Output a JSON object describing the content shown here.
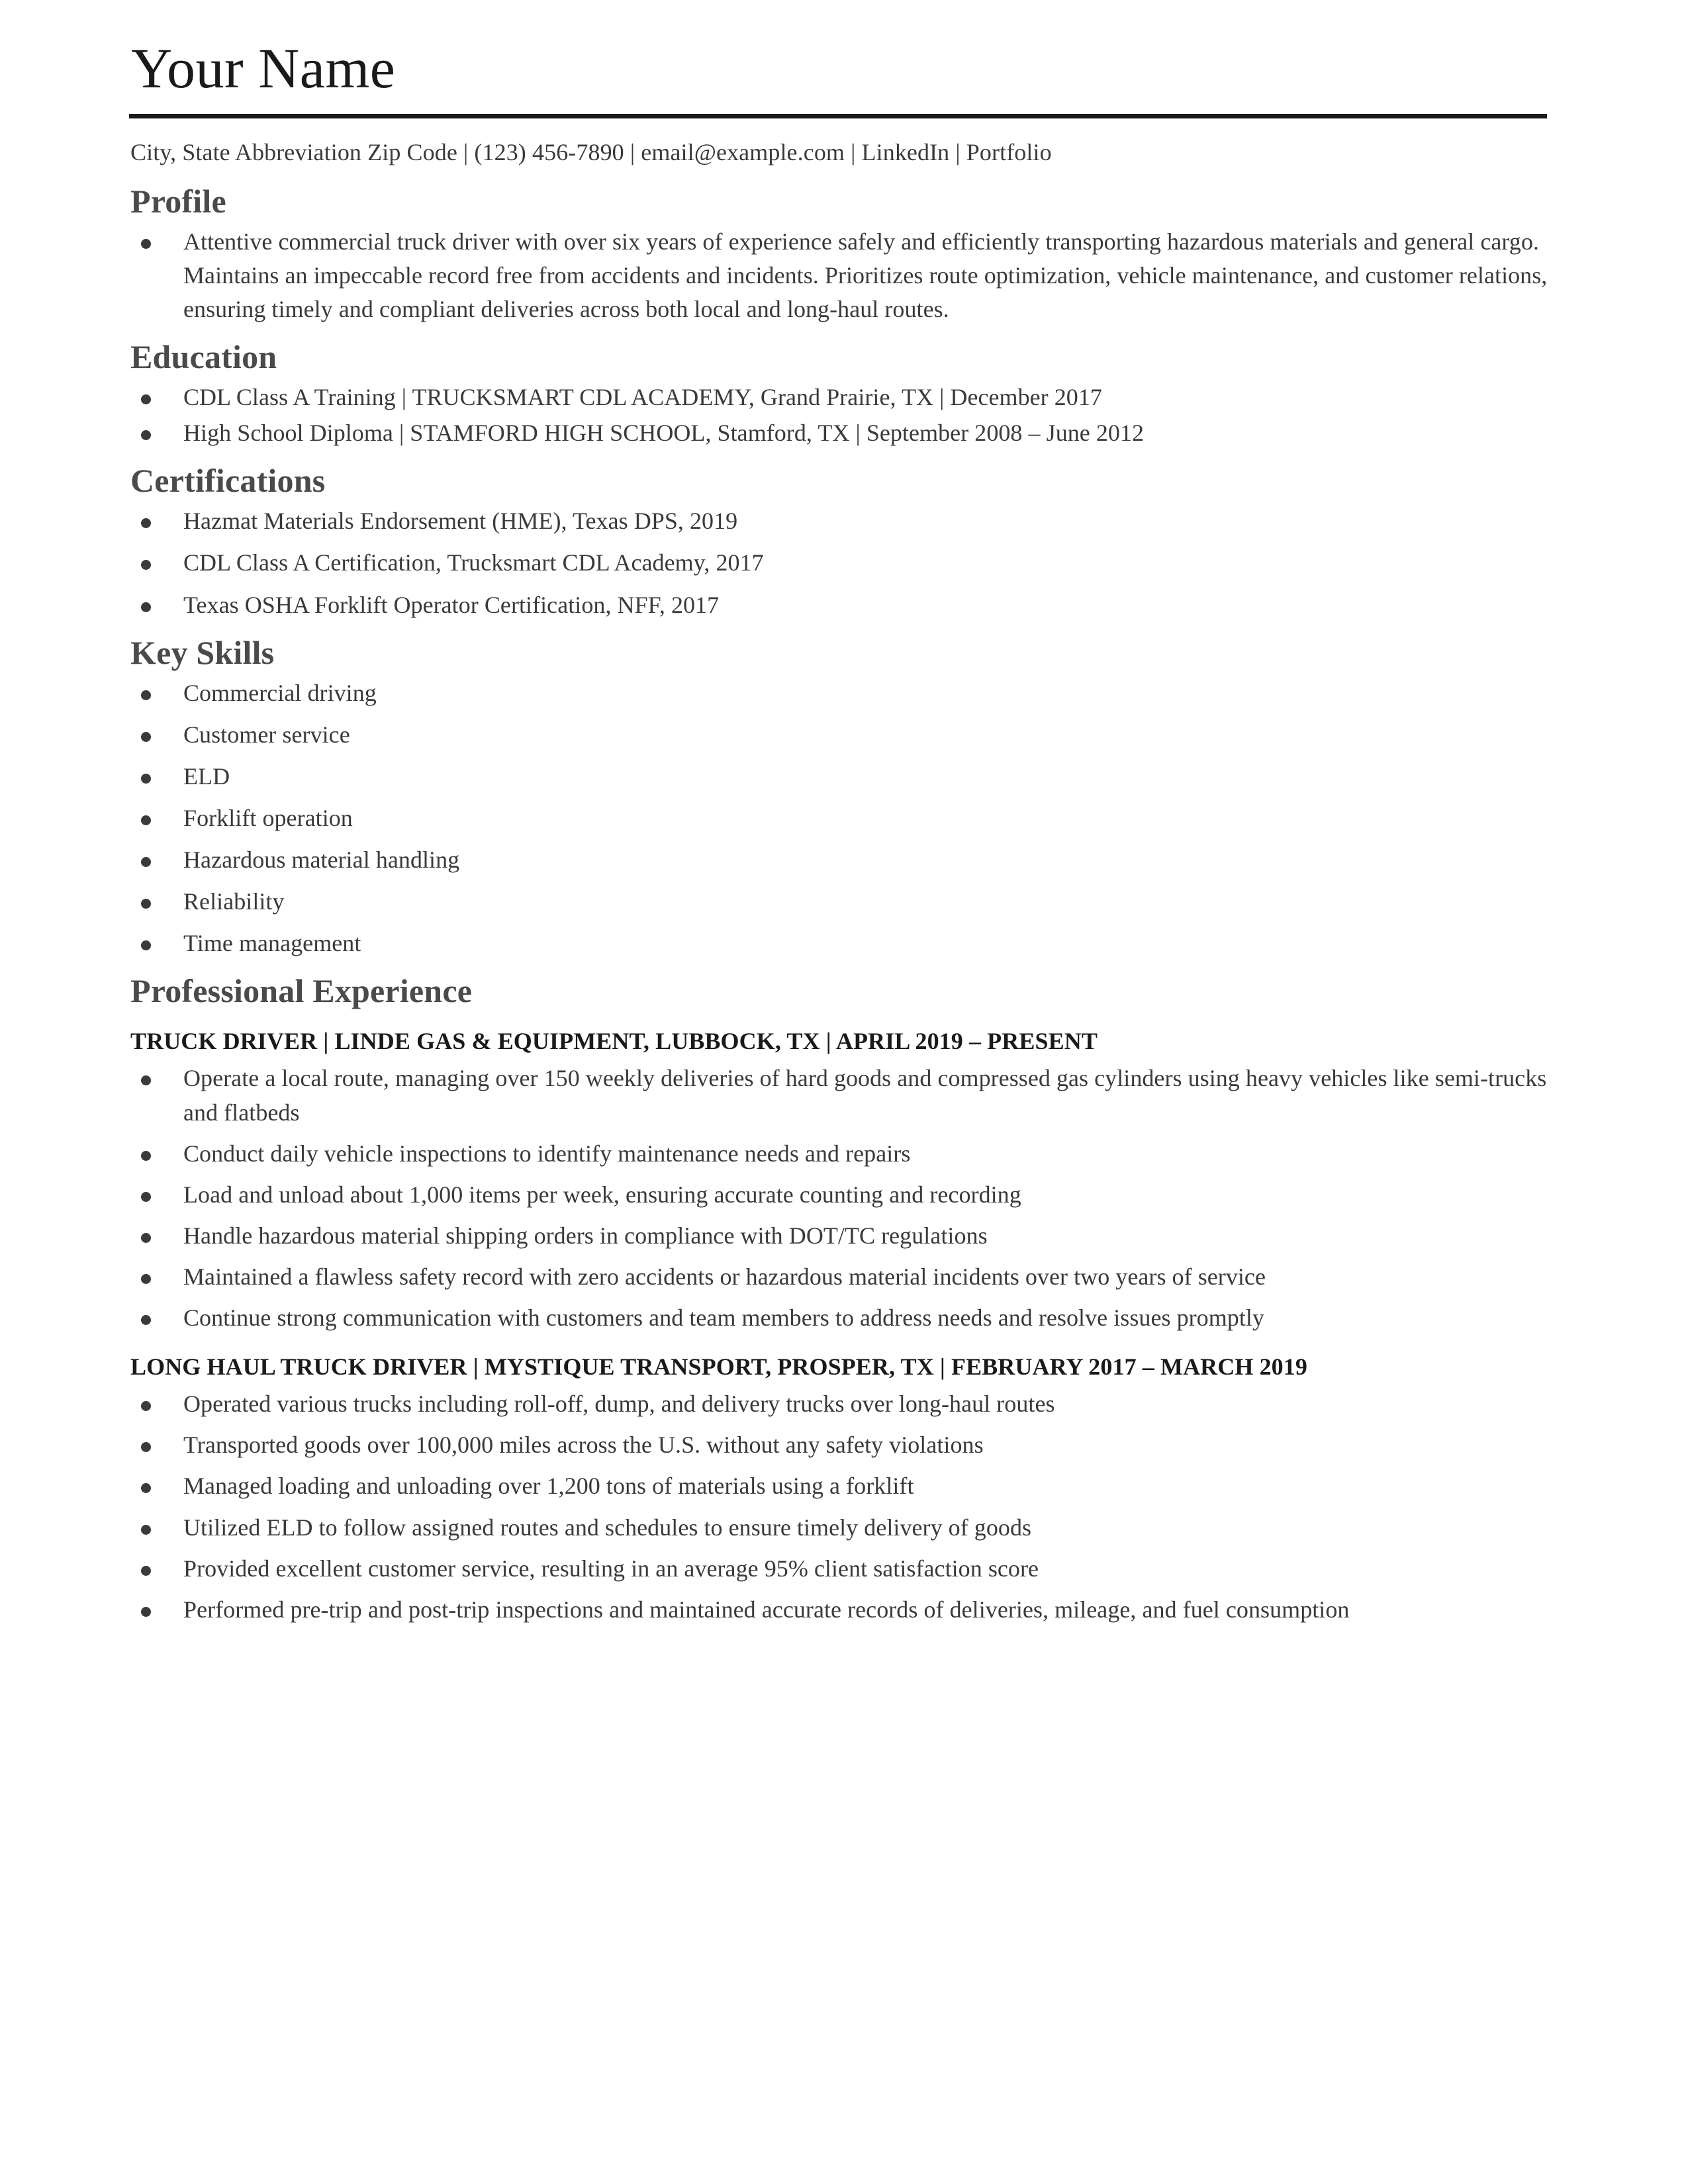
{
  "header": {
    "name": "Your Name",
    "contact": "City, State Abbreviation Zip Code | (123) 456-7890 | email@example.com | LinkedIn | Portfolio"
  },
  "sections": {
    "profile": {
      "title": "Profile",
      "items": [
        "Attentive commercial truck driver with over six years of experience safely and efficiently transporting hazardous materials and general cargo. Maintains an impeccable record free from accidents and incidents. Prioritizes route optimization, vehicle maintenance, and customer relations, ensuring timely and compliant deliveries across both local and long-haul routes."
      ]
    },
    "education": {
      "title": "Education",
      "items": [
        "CDL Class A Training | TRUCKSMART CDL ACADEMY, Grand Prairie, TX | December 2017",
        "High School Diploma | STAMFORD HIGH SCHOOL, Stamford, TX | September 2008 – June 2012"
      ]
    },
    "certifications": {
      "title": "Certifications",
      "items": [
        "Hazmat Materials Endorsement (HME), Texas DPS, 2019",
        "CDL Class A Certification, Trucksmart CDL Academy, 2017",
        "Texas OSHA Forklift Operator Certification, NFF, 2017"
      ]
    },
    "key_skills": {
      "title": "Key Skills",
      "items": [
        "Commercial driving",
        "Customer service",
        "ELD",
        "Forklift operation",
        "Hazardous material handling",
        "Reliability",
        "Time management"
      ]
    },
    "experience": {
      "title": "Professional Experience",
      "jobs": [
        {
          "heading": "TRUCK DRIVER | LINDE GAS & EQUIPMENT, LUBBOCK, TX | APRIL 2019 – PRESENT",
          "bullets": [
            "Operate a local route, managing over 150 weekly deliveries of hard goods and compressed gas cylinders using heavy vehicles like semi-trucks and flatbeds",
            "Conduct daily vehicle inspections to identify maintenance needs and repairs",
            "Load and unload about 1,000 items per week, ensuring accurate counting and recording",
            "Handle hazardous material shipping orders in compliance with DOT/TC regulations",
            "Maintained a flawless safety record with zero accidents or hazardous material incidents over two years of service",
            "Continue strong communication with customers and team members to address needs and resolve issues promptly"
          ]
        },
        {
          "heading": "LONG HAUL TRUCK DRIVER | MYSTIQUE TRANSPORT, PROSPER, TX | FEBRUARY 2017 – MARCH 2019",
          "bullets": [
            "Operated various trucks including roll-off, dump, and delivery trucks over long-haul routes",
            "Transported goods over 100,000 miles across the U.S. without any safety violations",
            "Managed loading and unloading over 1,200 tons of materials using a forklift",
            "Utilized ELD to follow assigned routes and schedules to ensure timely delivery of goods",
            "Provided excellent customer service, resulting in an average 95% client satisfaction score",
            "Performed pre-trip and post-trip inspections and maintained accurate records of deliveries, mileage, and fuel consumption"
          ]
        }
      ]
    }
  }
}
